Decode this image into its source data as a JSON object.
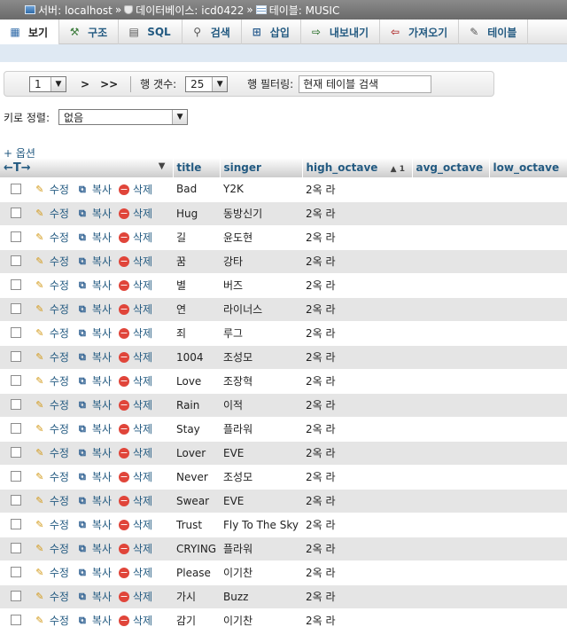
{
  "breadcrumb": {
    "server_label": "서버: localhost",
    "database_label": "데이터베이스: icd0422",
    "table_label": "테이블: MUSIC",
    "separator": "»"
  },
  "tabs": [
    {
      "label": "보기",
      "icon": "browse-icon",
      "active": true
    },
    {
      "label": "구조",
      "icon": "structure-icon",
      "active": false
    },
    {
      "label": "SQL",
      "icon": "sql-icon",
      "active": false
    },
    {
      "label": "검색",
      "icon": "search-icon",
      "active": false
    },
    {
      "label": "삽입",
      "icon": "insert-icon",
      "active": false
    },
    {
      "label": "내보내기",
      "icon": "export-icon",
      "active": false
    },
    {
      "label": "가져오기",
      "icon": "import-icon",
      "active": false
    },
    {
      "label": "테이블",
      "icon": "operations-icon",
      "active": false
    }
  ],
  "navigation": {
    "page_value": "1",
    "next": ">",
    "last": ">>",
    "rows_label": "행 갯수:",
    "rows_value": "25",
    "filter_label": "행 필터링:",
    "filter_placeholder": "현재 테이블 검색"
  },
  "sort": {
    "label": "키로 정렬:",
    "value": "없음"
  },
  "options_label": "+ 옵션",
  "table": {
    "select_all_arrows": "←T→",
    "columns": [
      "title",
      "singer",
      "high_octave",
      "avg_octave",
      "low_octave"
    ],
    "sort_indicator": "▲ 1",
    "actions": {
      "edit": "수정",
      "copy": "복사",
      "delete": "삭제"
    },
    "rows": [
      {
        "title": "Bad",
        "singer": "Y2K",
        "high_octave": "2옥 라"
      },
      {
        "title": "Hug",
        "singer": "동방신기",
        "high_octave": "2옥 라"
      },
      {
        "title": "길",
        "singer": "윤도현",
        "high_octave": "2옥 라"
      },
      {
        "title": "꿈",
        "singer": "강타",
        "high_octave": "2옥 라"
      },
      {
        "title": "별",
        "singer": "버즈",
        "high_octave": "2옥 라"
      },
      {
        "title": "연",
        "singer": "라이너스",
        "high_octave": "2옥 라"
      },
      {
        "title": "죄",
        "singer": "루그",
        "high_octave": "2옥 라"
      },
      {
        "title": "1004",
        "singer": "조성모",
        "high_octave": "2옥 라"
      },
      {
        "title": "Love",
        "singer": "조장혁",
        "high_octave": "2옥 라"
      },
      {
        "title": "Rain",
        "singer": "이적",
        "high_octave": "2옥 라"
      },
      {
        "title": "Stay",
        "singer": "플라워",
        "high_octave": "2옥 라"
      },
      {
        "title": "Lover",
        "singer": "EVE",
        "high_octave": "2옥 라"
      },
      {
        "title": "Never",
        "singer": "조성모",
        "high_octave": "2옥 라"
      },
      {
        "title": "Swear",
        "singer": "EVE",
        "high_octave": "2옥 라"
      },
      {
        "title": "Trust",
        "singer": "Fly To The Sky",
        "high_octave": "2옥 라"
      },
      {
        "title": "CRYING",
        "singer": "플라워",
        "high_octave": "2옥 라"
      },
      {
        "title": "Please",
        "singer": "이기찬",
        "high_octave": "2옥 라"
      },
      {
        "title": "가시",
        "singer": "Buzz",
        "high_octave": "2옥 라"
      },
      {
        "title": "감기",
        "singer": "이기찬",
        "high_octave": "2옥 라"
      }
    ]
  }
}
